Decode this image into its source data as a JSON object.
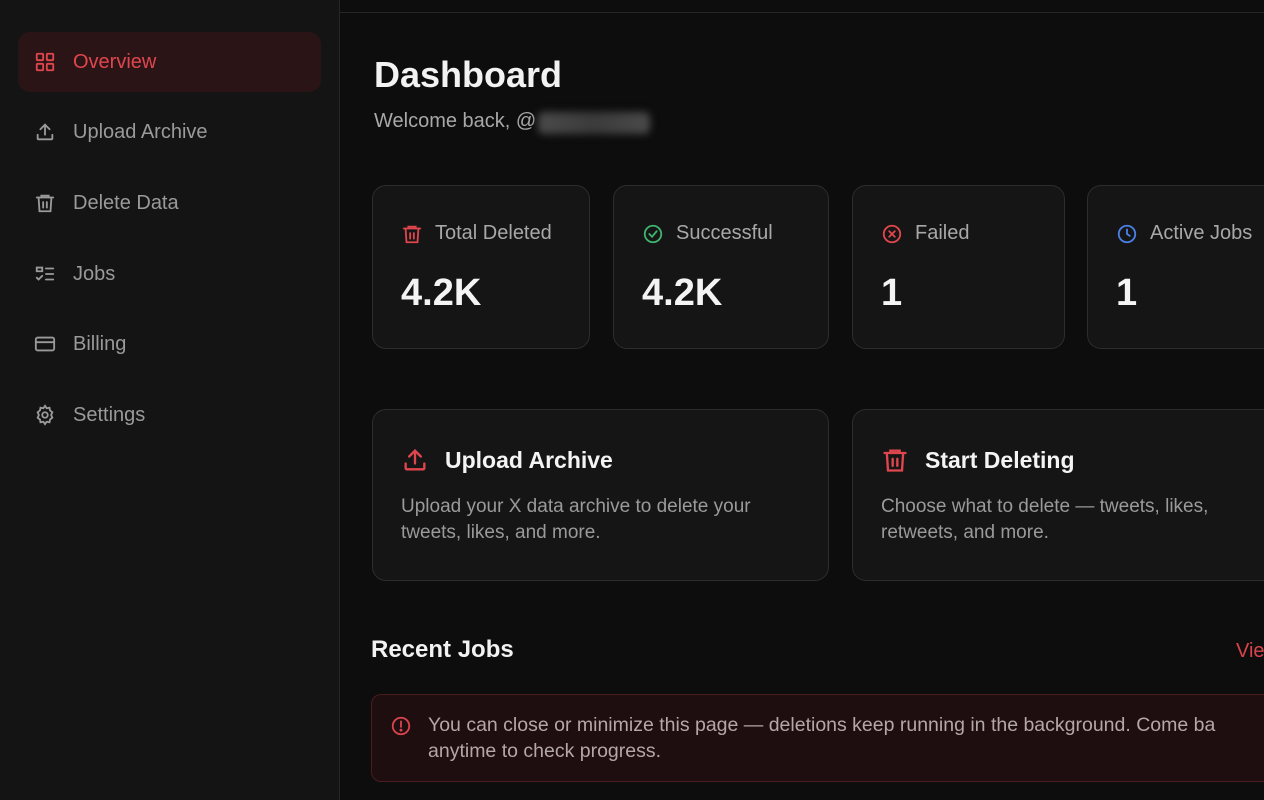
{
  "sidebar": {
    "items": [
      {
        "label": "Overview",
        "icon": "grid-icon",
        "active": true
      },
      {
        "label": "Upload Archive",
        "icon": "upload-icon"
      },
      {
        "label": "Delete Data",
        "icon": "trash-icon"
      },
      {
        "label": "Jobs",
        "icon": "list-check-icon"
      },
      {
        "label": "Billing",
        "icon": "credit-card-icon"
      },
      {
        "label": "Settings",
        "icon": "gear-icon"
      }
    ]
  },
  "header": {
    "title": "Dashboard",
    "welcome_prefix": "Welcome back, @"
  },
  "stats": [
    {
      "label": "Total Deleted",
      "value": "4.2K",
      "icon": "trash-icon",
      "color": "#e0464d"
    },
    {
      "label": "Successful",
      "value": "4.2K",
      "icon": "check-circle-icon",
      "color": "#3fb26b"
    },
    {
      "label": "Failed",
      "value": "1",
      "icon": "x-circle-icon",
      "color": "#e0464d"
    },
    {
      "label": "Active Jobs",
      "value": "1",
      "icon": "clock-icon",
      "color": "#4a7fe6"
    }
  ],
  "actions": [
    {
      "title": "Upload Archive",
      "description": "Upload your X data archive to delete your tweets, likes, and more.",
      "icon": "upload-icon"
    },
    {
      "title": "Start Deleting",
      "description": "Choose what to delete — tweets, likes, retweets, and more.",
      "icon": "trash-icon"
    }
  ],
  "recent_jobs": {
    "title": "Recent Jobs",
    "view_link": "Vie",
    "notice": "You can close or minimize this page — deletions keep running in the background. Come ba anytime to check progress."
  },
  "colors": {
    "accent": "#e0464d",
    "success": "#3fb26b",
    "info": "#4a7fe6"
  }
}
